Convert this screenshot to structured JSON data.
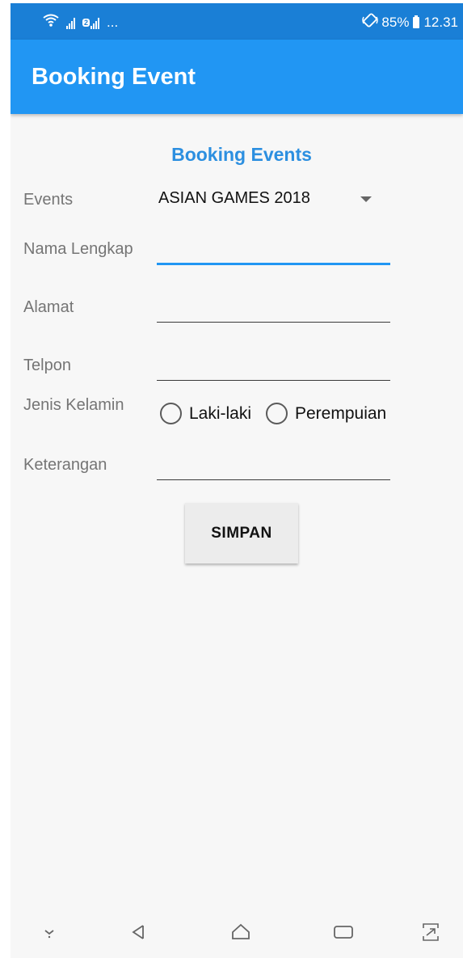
{
  "status_bar": {
    "sim_badge": "2",
    "dots": "...",
    "battery_percent": "85%",
    "time": "12.31"
  },
  "app_bar": {
    "title": "Booking Event"
  },
  "form": {
    "heading": "Booking Events",
    "events": {
      "label": "Events",
      "selected": "ASIAN GAMES 2018"
    },
    "full_name": {
      "label": "Nama Lengkap",
      "value": ""
    },
    "address": {
      "label": "Alamat",
      "value": ""
    },
    "phone": {
      "label": "Telpon",
      "value": ""
    },
    "gender": {
      "label": "Jenis Kelamin",
      "options": [
        {
          "label": "Laki-laki",
          "selected": false
        },
        {
          "label": "Perempuian",
          "selected": false
        }
      ]
    },
    "notes": {
      "label": "Keterangan",
      "value": ""
    },
    "save_label": "SIMPAN"
  },
  "nav_bar": {
    "icons": [
      "collapse-icon",
      "back-icon",
      "home-icon",
      "recents-icon",
      "screenshot-icon"
    ]
  },
  "colors": {
    "status_bar": "#1a7fd6",
    "app_bar": "#2196f3",
    "heading": "#2c8fe0",
    "focused_underline": "#2196f3",
    "background": "#f7f7f7"
  }
}
